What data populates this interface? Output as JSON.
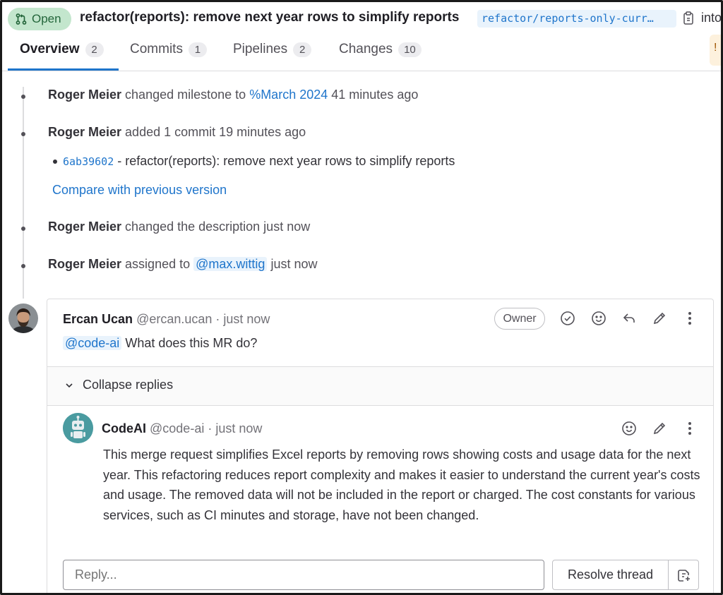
{
  "header": {
    "status": "Open",
    "title": "refactor(reports): remove next year rows to simplify reports",
    "source_branch": "refactor/reports-only-curr…",
    "into_label": "into"
  },
  "tabs": [
    {
      "label": "Overview",
      "count": "2",
      "active": true
    },
    {
      "label": "Commits",
      "count": "1"
    },
    {
      "label": "Pipelines",
      "count": "2"
    },
    {
      "label": "Changes",
      "count": "10"
    }
  ],
  "timeline": {
    "e1": {
      "author": "Roger Meier",
      "action": "changed milestone to",
      "link": "%March 2024",
      "time": "41 minutes ago"
    },
    "e2": {
      "author": "Roger Meier",
      "action": "added 1 commit 19 minutes ago"
    },
    "commit": {
      "sha": "6ab39602",
      "message": "- refactor(reports): remove next year rows to simplify reports"
    },
    "compare_link": "Compare with previous version",
    "e3": {
      "author": "Roger Meier",
      "action": "changed the description just now"
    },
    "e4": {
      "author": "Roger Meier",
      "action": "assigned to",
      "mention": "@max.wittig",
      "time": "just now"
    }
  },
  "discussion": {
    "note": {
      "author": "Ercan Ucan",
      "handle": "@ercan.ucan · just now",
      "badge": "Owner",
      "mention": "@code-ai",
      "text": "What does this MR do?"
    },
    "collapse_label": "Collapse replies",
    "reply": {
      "author": "CodeAI",
      "handle": "@code-ai · just now",
      "text": "This merge request simplifies Excel reports by removing rows showing costs and usage data for the next year. This refactoring reduces report complexity and makes it easier to understand the current year's costs and usage. The removed data will not be included in the report or charged. The cost constants for various services, such as CI minutes and storage, have not been changed."
    },
    "reply_placeholder": "Reply...",
    "resolve_label": "Resolve thread"
  },
  "colors": {
    "accent": "#1f75cb",
    "open_bg": "#c3e6cd",
    "open_fg": "#24663b"
  }
}
